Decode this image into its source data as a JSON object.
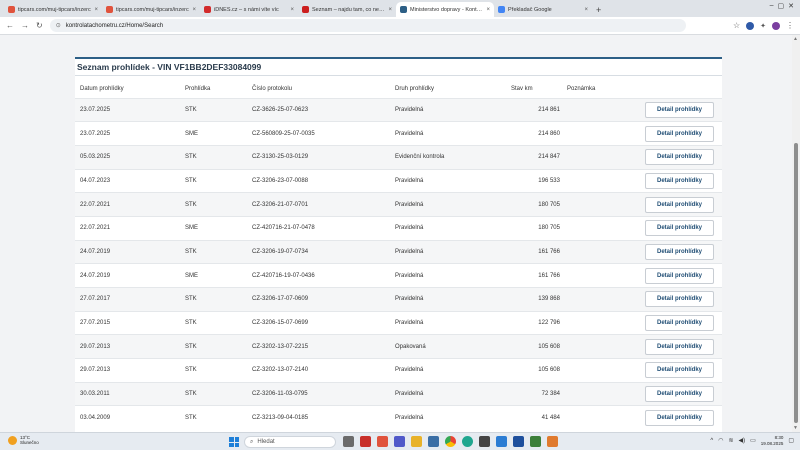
{
  "browser": {
    "tabs": [
      {
        "title": "tipcars.com/muj-tipcars/inzerc",
        "active": false,
        "color": "#e0533d"
      },
      {
        "title": "tipcars.com/muj-tipcars/inzerc",
        "active": false,
        "color": "#e0533d"
      },
      {
        "title": "iDNES.cz – s námi víte víc",
        "active": false,
        "color": "#d22b2b"
      },
      {
        "title": "Seznam – najdu tam, co neznám",
        "active": false,
        "color": "#cc1f1f"
      },
      {
        "title": "Ministerstvo dopravy - Kontrola",
        "active": true,
        "color": "#2d5f86"
      },
      {
        "title": "Překladač Google",
        "active": false,
        "color": "#4285f4"
      }
    ],
    "url": "kontrolatachometru.cz/Home/Search"
  },
  "page": {
    "title": "Seznam prohlídek - VIN VF1BB2DEF33084099",
    "columns": [
      "Datum prohlídky",
      "Prohlídka",
      "Číslo protokolu",
      "Druh prohlídky",
      "Stav km",
      "Poznámka"
    ],
    "detail_label": "Detail prohlídky",
    "rows": [
      {
        "date": "23.07.2025",
        "type": "STK",
        "protocol": "CZ-3626-25-07-0623",
        "kind": "Pravidelná",
        "km": "214 861",
        "note": ""
      },
      {
        "date": "23.07.2025",
        "type": "SME",
        "protocol": "CZ-560809-25-07-0035",
        "kind": "Pravidelná",
        "km": "214 860",
        "note": ""
      },
      {
        "date": "05.03.2025",
        "type": "STK",
        "protocol": "CZ-3130-25-03-0129",
        "kind": "Evidenční kontrola",
        "km": "214 847",
        "note": ""
      },
      {
        "date": "04.07.2023",
        "type": "STK",
        "protocol": "CZ-3206-23-07-0088",
        "kind": "Pravidelná",
        "km": "196 533",
        "note": ""
      },
      {
        "date": "22.07.2021",
        "type": "STK",
        "protocol": "CZ-3206-21-07-0701",
        "kind": "Pravidelná",
        "km": "180 705",
        "note": ""
      },
      {
        "date": "22.07.2021",
        "type": "SME",
        "protocol": "CZ-420716-21-07-0478",
        "kind": "Pravidelná",
        "km": "180 705",
        "note": ""
      },
      {
        "date": "24.07.2019",
        "type": "STK",
        "protocol": "CZ-3206-19-07-0734",
        "kind": "Pravidelná",
        "km": "161 766",
        "note": ""
      },
      {
        "date": "24.07.2019",
        "type": "SME",
        "protocol": "CZ-420716-19-07-0436",
        "kind": "Pravidelná",
        "km": "161 766",
        "note": ""
      },
      {
        "date": "27.07.2017",
        "type": "STK",
        "protocol": "CZ-3206-17-07-0609",
        "kind": "Pravidelná",
        "km": "139 868",
        "note": ""
      },
      {
        "date": "27.07.2015",
        "type": "STK",
        "protocol": "CZ-3206-15-07-0699",
        "kind": "Pravidelná",
        "km": "122 796",
        "note": ""
      },
      {
        "date": "29.07.2013",
        "type": "STK",
        "protocol": "CZ-3202-13-07-2215",
        "kind": "Opakovaná",
        "km": "105 608",
        "note": ""
      },
      {
        "date": "29.07.2013",
        "type": "STK",
        "protocol": "CZ-3202-13-07-2140",
        "kind": "Pravidelná",
        "km": "105 608",
        "note": ""
      },
      {
        "date": "30.03.2011",
        "type": "STK",
        "protocol": "CZ-3206-11-03-0795",
        "kind": "Pravidelná",
        "km": "72 384",
        "note": ""
      },
      {
        "date": "03.04.2009",
        "type": "STK",
        "protocol": "CZ-3213-09-04-0185",
        "kind": "Pravidelná",
        "km": "41 484",
        "note": ""
      }
    ]
  },
  "taskbar": {
    "weather_temp": "13°C",
    "weather_desc": "Slunečno",
    "search_placeholder": "Hledat",
    "time": "8:30",
    "date": "19.08.2025"
  }
}
